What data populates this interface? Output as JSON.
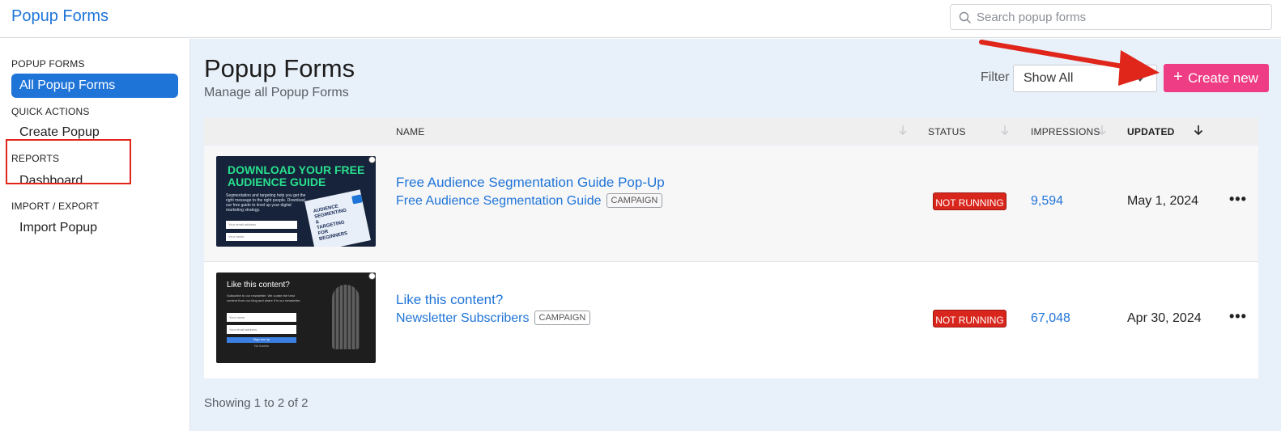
{
  "app": {
    "title": "Popup Forms"
  },
  "search": {
    "placeholder": "Search popup forms",
    "icon": "search-icon"
  },
  "sidebar": {
    "sections": [
      {
        "heading": "POPUP FORMS",
        "items": [
          "All Popup Forms"
        ]
      },
      {
        "heading": "QUICK ACTIONS",
        "items": [
          "Create Popup"
        ]
      },
      {
        "heading": "REPORTS",
        "items": [
          "Dashboard"
        ]
      },
      {
        "heading": "IMPORT / EXPORT",
        "items": [
          "Import Popup"
        ]
      }
    ],
    "active_item": "All Popup Forms"
  },
  "main": {
    "title": "Popup Forms",
    "subtitle": "Manage all Popup Forms",
    "filter_label": "Filter",
    "filter_value": "Show All",
    "create_button": "Create new",
    "create_icon": "+",
    "columns": [
      "NAME",
      "STATUS",
      "IMPRESSIONS",
      "UPDATED"
    ],
    "rows": [
      {
        "title": "Free Audience Segmentation Guide Pop-Up",
        "subtitle": "Free Audience Segmentation Guide",
        "tag": "CAMPAIGN",
        "status": "NOT RUNNING",
        "impressions": "9,594",
        "updated": "May 1, 2024",
        "thumbnail": {
          "headline": "DOWNLOAD YOUR FREE AUDIENCE GUIDE",
          "text": "Segmentation and targeting help you get the right message to the right people. Download our free guide to level up your digital marketing strategy.",
          "field1": "Your email address",
          "field2": "Your name",
          "book": "AUDIENCE SEGMENTING & TARGETING FOR BEGINNERS"
        }
      },
      {
        "title": "Like this content?",
        "subtitle": "Newsletter Subscribers",
        "tag": "CAMPAIGN",
        "status": "NOT RUNNING",
        "impressions": "67,048",
        "updated": "Apr 30, 2024",
        "thumbnail": {
          "headline": "Like this content?",
          "text": "Subscribe to our newsletter. We curate the best content from our blog and share it in our newsletter.",
          "field1": "Your name",
          "field2": "Your email address",
          "button": "Sign me up",
          "secondary": "No thanks"
        }
      }
    ],
    "pagination": "Showing 1 to 2 of 2"
  },
  "more_icon": "•••",
  "colors": {
    "accent": "#1f74d8",
    "create": "#ee3d85",
    "status_red": "#d9261c",
    "annotation": "#e0261b"
  }
}
